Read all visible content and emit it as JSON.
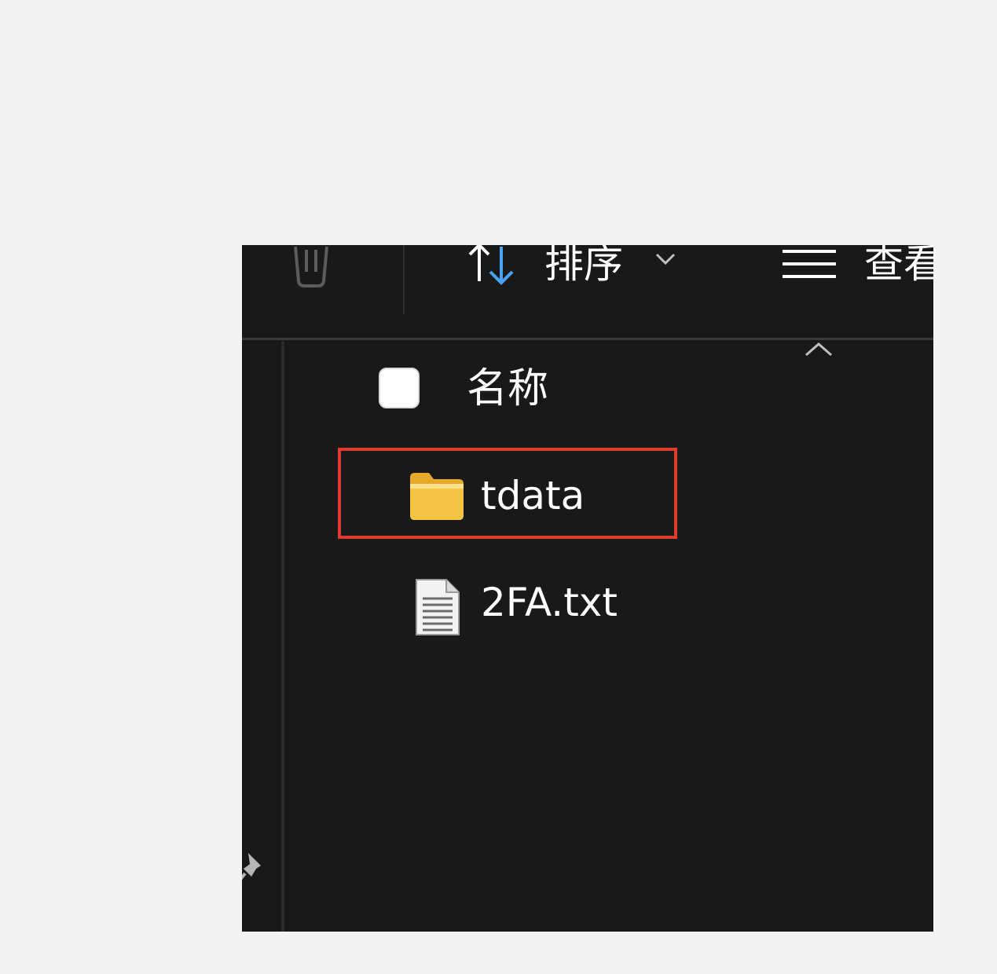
{
  "toolbar": {
    "delete_icon": "trash-icon",
    "sort_icon": "sort-arrows-icon",
    "sort_label": "排序",
    "sort_dropdown_icon": "chevron-down-icon",
    "view_icon": "hamburger-lines-icon",
    "view_label": "查看"
  },
  "column_header": {
    "sort_indicator_icon": "chevron-up-icon",
    "name_label": "名称"
  },
  "files": [
    {
      "name": "tdata",
      "icon": "folder-icon",
      "highlighted": true
    },
    {
      "name": "2FA.txt",
      "icon": "text-file-icon",
      "highlighted": false
    }
  ],
  "nav_pane": {
    "pin_icon": "pin-icon"
  },
  "colors": {
    "window_background": "#191919",
    "page_background": "#f3f3f3",
    "highlight_border": "#e03a2e",
    "folder_yellow": "#f6c444",
    "sort_accent_blue": "#4aa3f0"
  }
}
